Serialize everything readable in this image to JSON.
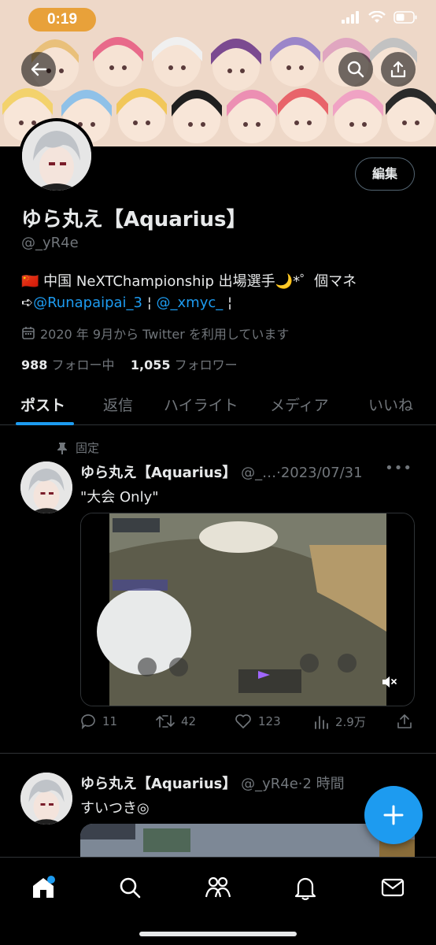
{
  "status_bar": {
    "time": "0:19"
  },
  "profile": {
    "edit_label": "編集",
    "name": "ゆら丸え【Aquarius】",
    "handle": "@_yR4e",
    "bio_line1": "🇨🇳 中国 NeXTChampionship 出場選手🌙*゜個マネ",
    "bio_line2_prefix": "➪",
    "bio_link1": "@Runapaipai_3",
    "bio_sep1": " ¦ ",
    "bio_link2": "@_xmyc_",
    "bio_sep2": " ¦",
    "joined": "2020 年 9月から Twitter を利用しています",
    "following_count": "988",
    "following_label": "フォロー中",
    "followers_count": "1,055",
    "followers_label": "フォロワー"
  },
  "tabs": [
    "ポスト",
    "返信",
    "ハイライト",
    "メディア",
    "いいね"
  ],
  "tweets": [
    {
      "pinned_label": "固定",
      "name": "ゆら丸え【Aquarius】",
      "handle": "@_…",
      "date": "·2023/07/31",
      "text": "\"大会 Only\"",
      "replies": "11",
      "retweets": "42",
      "likes": "123",
      "views": "2.9万"
    },
    {
      "name": "ゆら丸え【Aquarius】",
      "handle": "@_yR4e",
      "date": "·2 時間",
      "text": "すいつき◎"
    }
  ],
  "bottom_nav": [
    "home-icon",
    "search-icon",
    "communities-icon",
    "notifications-icon",
    "messages-icon"
  ],
  "colors": {
    "accent": "#1d9bf0",
    "muted": "#71767b",
    "background": "#000000",
    "time_pill": "#e8a13a"
  }
}
